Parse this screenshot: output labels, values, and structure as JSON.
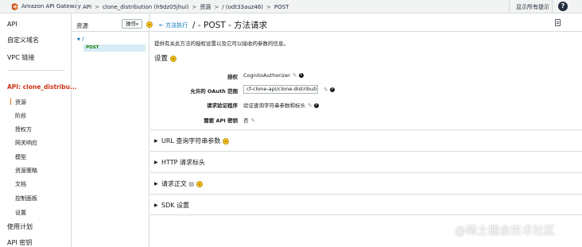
{
  "topbar": {
    "brand": "Amazon API Gateway",
    "breadcrumbs": [
      "API",
      "clone_distribution (h9dz05jhui)",
      "资源",
      "/ (odt33auz46)",
      "POST"
    ],
    "show_hints": "显示所有提示"
  },
  "nav": {
    "api": "API",
    "custom_domains": "自定义域名",
    "vpc_links": "VPC 链接",
    "current_api": "API: clone_distribu...",
    "sub_items": [
      "资源",
      "阶段",
      "授权方",
      "网关响应",
      "模型",
      "资源策略",
      "文档",
      "控制面板",
      "设置"
    ],
    "usage_plans": "使用计划",
    "api_keys": "API 密钥"
  },
  "resources": {
    "title": "资源",
    "actions_label": "操作",
    "tree_root": "/",
    "tree_method": "POST"
  },
  "main": {
    "back_link": "方法执行",
    "title": "/ - POST - 方法请求",
    "description": "提供有关此方法的授权设置以及它可以接收的参数的信息。",
    "settings_heading": "设置",
    "rows": {
      "auth_label": "授权",
      "auth_value": "CognitoAuthorizer",
      "oauth_label": "允许的 OAuth 范围",
      "oauth_value": "cf-clone-api/clone-distribution",
      "validator_label": "请求验证程序",
      "validator_value": "验证查询字符串参数和标头",
      "apikey_label": "需要 API 密钥",
      "apikey_value": "否"
    },
    "sections": {
      "query": "URL 查询字符串参数",
      "headers": "HTTP 请求标头",
      "body": "请求正文",
      "sdk": "SDK 设置"
    }
  },
  "watermark": "@稀土掘金技术社区",
  "colors": {
    "accent": "#ec7211",
    "link": "#0073bb",
    "current_api": "#d13212",
    "selected_bg": "#d6ecf5"
  }
}
